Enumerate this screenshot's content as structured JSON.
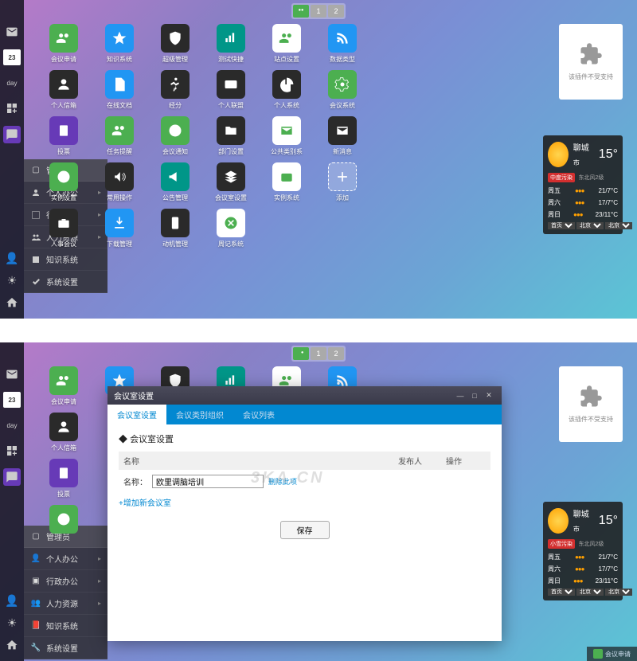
{
  "topbar": {
    "btn1": "1",
    "btn2": "2"
  },
  "leftbar": {
    "cal_day": "23",
    "cal_sub": "day"
  },
  "sidemenu": {
    "head": "管理员",
    "items": [
      {
        "label": "个人办公",
        "arrow": true
      },
      {
        "label": "行政办公",
        "arrow": true
      },
      {
        "label": "人力资源",
        "arrow": true
      },
      {
        "label": "知识系统",
        "arrow": false
      },
      {
        "label": "系统设置",
        "arrow": false
      }
    ]
  },
  "apps_v1": [
    [
      {
        "label": "会议申请",
        "c": "c-green",
        "i": "people"
      },
      {
        "label": "知识系统",
        "c": "c-blue",
        "i": "star"
      },
      {
        "label": "超级管理",
        "c": "c-dark",
        "i": "shield"
      },
      {
        "label": "测试快捷",
        "c": "c-teal",
        "i": "signal"
      },
      {
        "label": "站点设置",
        "c": "c-white",
        "i": "people"
      },
      {
        "label": "数据类型",
        "c": "c-blue",
        "i": "rss"
      }
    ],
    [
      {
        "label": "个人信箱",
        "c": "c-dark",
        "i": "user"
      },
      {
        "label": "在线文档",
        "c": "c-blue",
        "i": "doc"
      },
      {
        "label": "经分",
        "c": "c-dark",
        "i": "run"
      },
      {
        "label": "个人联盟",
        "c": "c-dark",
        "i": "card"
      },
      {
        "label": "个人系统",
        "c": "c-dark",
        "i": "pie"
      },
      {
        "label": "会议系统",
        "c": "c-green",
        "i": "gear"
      }
    ],
    [
      {
        "label": "投票",
        "c": "c-purple",
        "i": "vote"
      },
      {
        "label": "任务提醒",
        "c": "c-green",
        "i": "people"
      },
      {
        "label": "会议通知",
        "c": "c-green",
        "i": "xbox"
      },
      {
        "label": "部门设置",
        "c": "c-dark",
        "i": "folder"
      },
      {
        "label": "公共类别系",
        "c": "c-white",
        "i": "mail"
      },
      {
        "label": "新消息",
        "c": "c-dark",
        "i": "mail"
      }
    ],
    [
      {
        "label": "实例设置",
        "c": "c-green",
        "i": "clock"
      },
      {
        "label": "常用操作",
        "c": "c-dark",
        "i": "sound"
      },
      {
        "label": "公告管理",
        "c": "c-teal",
        "i": "horn"
      },
      {
        "label": "会议室设置",
        "c": "c-dark",
        "i": "layers"
      },
      {
        "label": "实例系统",
        "c": "c-white",
        "i": "wallet"
      },
      {
        "label": "添加",
        "c": "c-dashed",
        "i": "plus"
      }
    ],
    [
      {
        "label": "人事会议",
        "c": "c-dark",
        "i": "briefcase"
      },
      {
        "label": "下载管理",
        "c": "c-blue",
        "i": "download"
      },
      {
        "label": "动机管理",
        "c": "c-dark",
        "i": "phone"
      },
      {
        "label": "周记系统",
        "c": "c-white",
        "i": "xbox"
      }
    ]
  ],
  "apps_v2": [
    [
      {
        "label": "会议申请",
        "c": "c-green",
        "i": "people"
      },
      {
        "label": "",
        "c": "c-blue",
        "i": "star"
      },
      {
        "label": "",
        "c": "c-dark",
        "i": "shield"
      },
      {
        "label": "",
        "c": "c-teal",
        "i": "signal"
      },
      {
        "label": "",
        "c": "c-white",
        "i": "people"
      },
      {
        "label": "",
        "c": "c-blue",
        "i": "rss"
      }
    ],
    [
      {
        "label": "个人信箱",
        "c": "c-dark",
        "i": "user"
      }
    ],
    [
      {
        "label": "投票",
        "c": "c-purple",
        "i": "vote"
      }
    ],
    [
      {
        "label": "",
        "c": "c-green",
        "i": "clock"
      }
    ]
  ],
  "plugin": {
    "text": "该插件不受支持"
  },
  "weather": {
    "city": "聊城",
    "city_suffix": "市",
    "badge1": "中度污染",
    "badge2": "小雪污染",
    "cond": "东北风2级",
    "temp": "15°",
    "rows": [
      {
        "day": "周五",
        "range": "21/7°C"
      },
      {
        "day": "周六",
        "range": "17/7°C"
      },
      {
        "day": "周日",
        "range": "23/11°C"
      }
    ],
    "sel": [
      "首页",
      "北京",
      "北京"
    ]
  },
  "dialog": {
    "title": "会议室设置",
    "tabs": [
      "会议室设置",
      "会议类别组织",
      "会议列表"
    ],
    "heading": "会议室设置",
    "th": {
      "name": "名称",
      "pub": "发布人",
      "op": "操作"
    },
    "row_label": "名称：",
    "row_value": "欧里调脑培训",
    "row_action": "删除此项",
    "add_link": "+增加新会议室",
    "save": "保存",
    "watermark": "3KA.CN"
  },
  "taskbar": {
    "item1": "会议申请"
  }
}
